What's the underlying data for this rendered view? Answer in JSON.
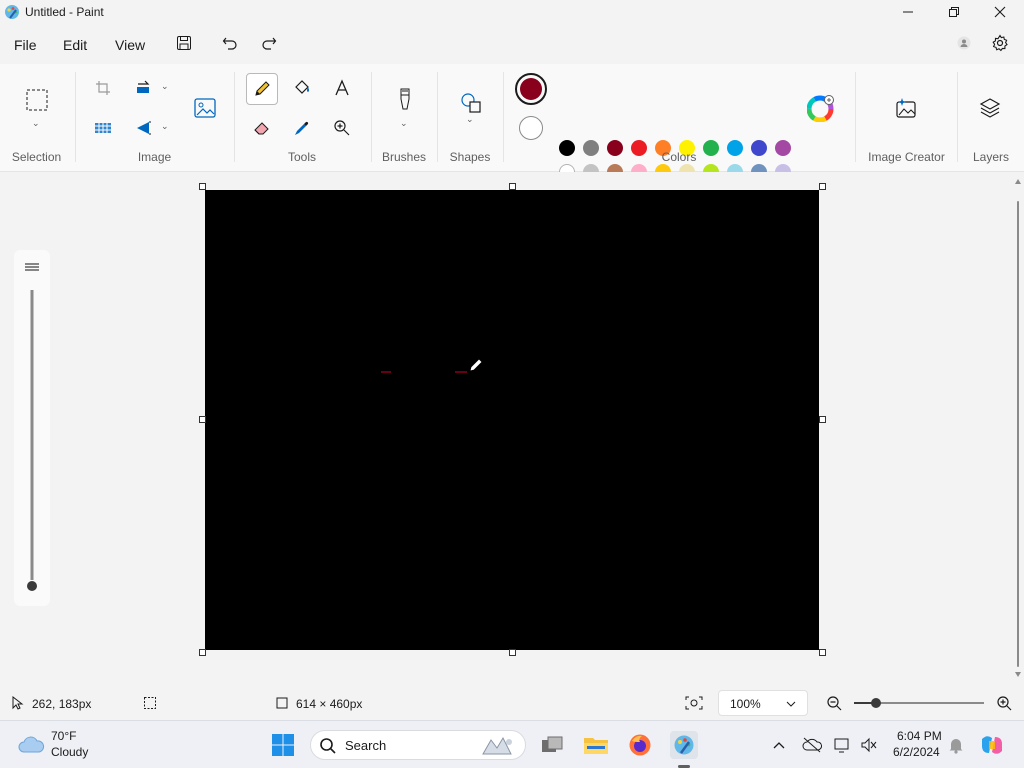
{
  "window": {
    "title": "Untitled - Paint"
  },
  "menu": {
    "file": "File",
    "edit": "Edit",
    "view": "View"
  },
  "ribbon": {
    "groups": {
      "selection": "Selection",
      "image": "Image",
      "tools": "Tools",
      "brushes": "Brushes",
      "shapes": "Shapes",
      "colors": "Colors",
      "image_creator": "Image Creator",
      "layers": "Layers"
    },
    "primary_color": "#88001b",
    "secondary_color": "#ffffff",
    "palette_row1": [
      "#000000",
      "#7f7f7f",
      "#88001b",
      "#ec1c24",
      "#ff7f27",
      "#fff200",
      "#22b14c",
      "#00a2e8",
      "#3f48cc",
      "#a349a4"
    ],
    "palette_row2": [
      "#ffffff",
      "#c3c3c3",
      "#b97a57",
      "#ffaec9",
      "#ffc90e",
      "#efe4b0",
      "#b5e61d",
      "#99d9ea",
      "#7092be",
      "#c8bfe7"
    ],
    "palette_row3_empty_count": 10
  },
  "canvas": {
    "background": "#000000"
  },
  "status": {
    "cursor_position": "262, 183px",
    "canvas_size": "614 × 460px",
    "zoom": "100%"
  },
  "taskbar": {
    "weather_temp": "70°F",
    "weather_desc": "Cloudy",
    "search_placeholder": "Search",
    "time": "6:04 PM",
    "date": "6/2/2024"
  }
}
